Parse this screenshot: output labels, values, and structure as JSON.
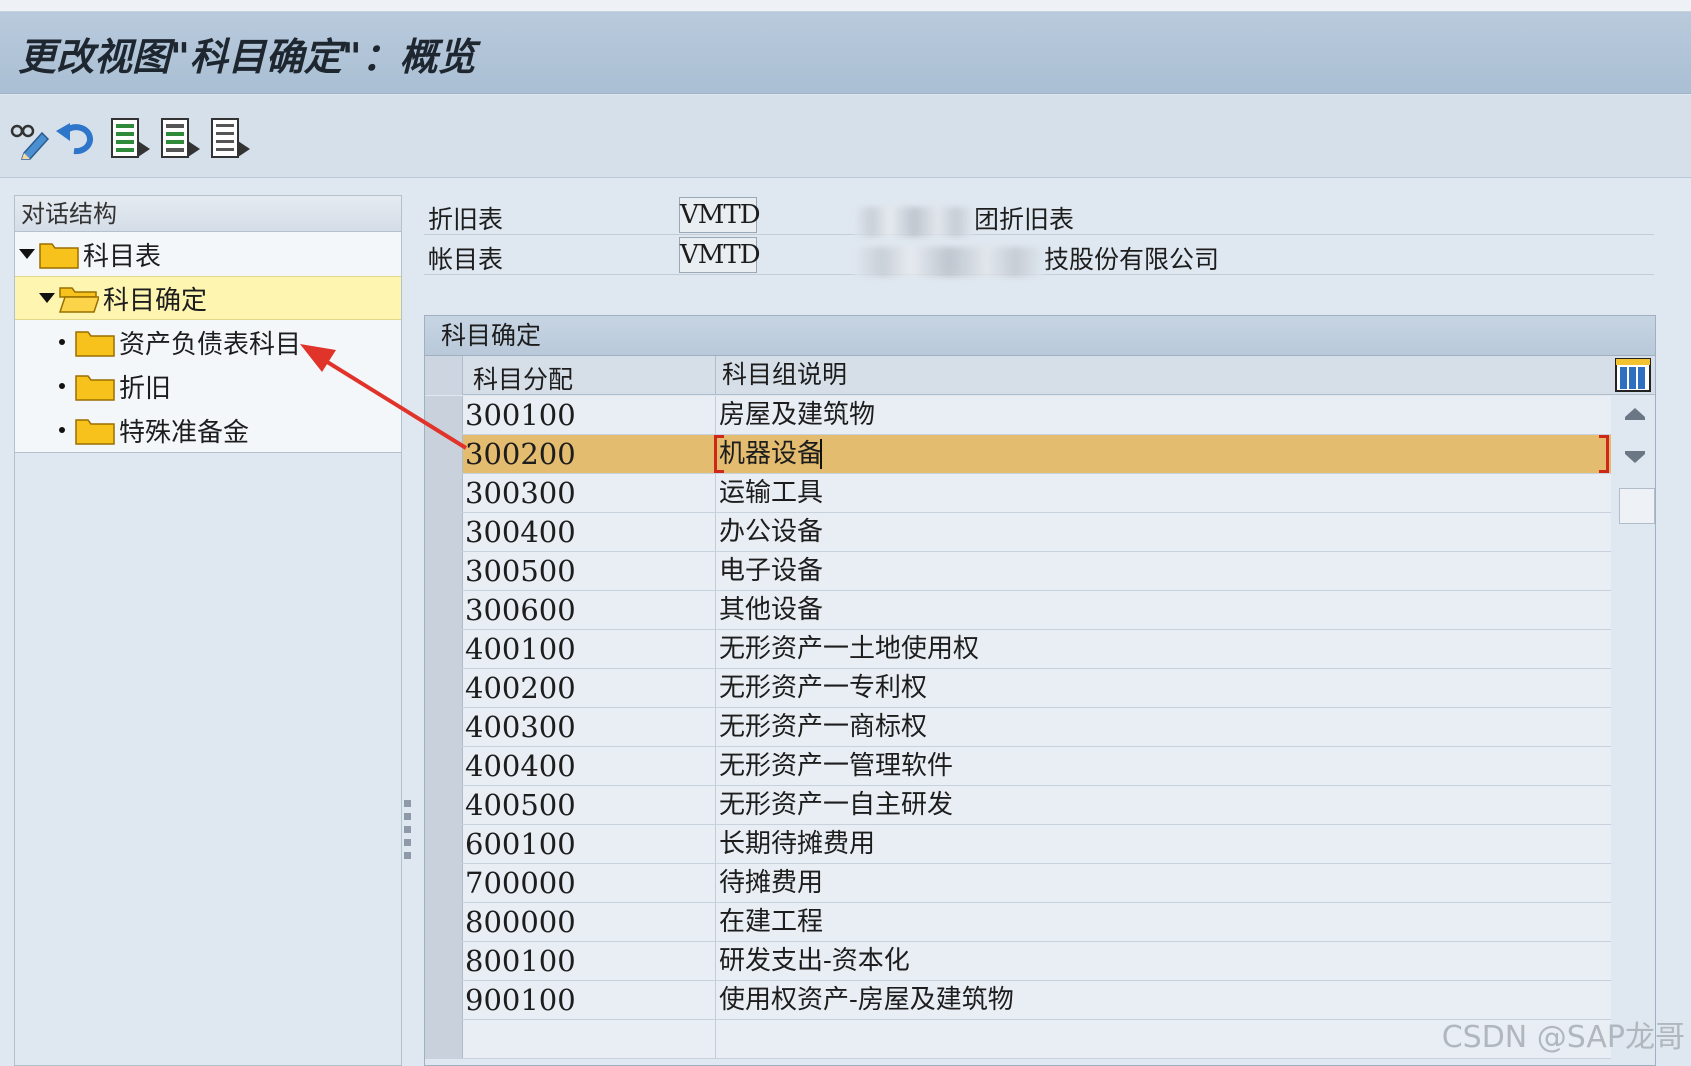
{
  "window": {
    "title": "更改视图\"科目确定\"：概览"
  },
  "toolbar": {
    "buttons": [
      {
        "icon": "display-change-icon"
      },
      {
        "icon": "undo-icon"
      },
      {
        "icon": "select-all-icon"
      },
      {
        "icon": "select-block-icon"
      },
      {
        "icon": "deselect-all-icon"
      }
    ]
  },
  "dialog_structure": {
    "header": "对话结构",
    "items": [
      {
        "label": "科目表"
      },
      {
        "label": "科目确定"
      },
      {
        "label": "资产负债表科目"
      },
      {
        "label": "折旧"
      },
      {
        "label": "特殊准备金"
      }
    ]
  },
  "header_fields": {
    "depr_area_label": "折旧表",
    "depr_area_value": "VMTD",
    "depr_area_desc": "团折旧表",
    "coa_label": "帐目表",
    "coa_value": "VMTD",
    "coa_desc": "技股份有限公司"
  },
  "table": {
    "title": "科目确定",
    "columns": [
      "科目分配",
      "科目组说明"
    ],
    "rows": [
      {
        "acct": "300100",
        "desc": "房屋及建筑物"
      },
      {
        "acct": "300200",
        "desc": "机器设备"
      },
      {
        "acct": "300300",
        "desc": "运输工具"
      },
      {
        "acct": "300400",
        "desc": "办公设备"
      },
      {
        "acct": "300500",
        "desc": "电子设备"
      },
      {
        "acct": "300600",
        "desc": "其他设备"
      },
      {
        "acct": "400100",
        "desc": "无形资产一土地使用权"
      },
      {
        "acct": "400200",
        "desc": "无形资产一专利权"
      },
      {
        "acct": "400300",
        "desc": "无形资产一商标权"
      },
      {
        "acct": "400400",
        "desc": "无形资产一管理软件"
      },
      {
        "acct": "400500",
        "desc": "无形资产一自主研发"
      },
      {
        "acct": "600100",
        "desc": "长期待摊费用"
      },
      {
        "acct": "700000",
        "desc": "待摊费用"
      },
      {
        "acct": "800000",
        "desc": "在建工程"
      },
      {
        "acct": "800100",
        "desc": "研发支出-资本化"
      },
      {
        "acct": "900100",
        "desc": "使用权资产-房屋及建筑物"
      },
      {
        "acct": "",
        "desc": ""
      }
    ]
  },
  "watermark": "CSDN @SAP龙哥",
  "colors": {
    "selected_row": "#e4bc70",
    "tree_selected": "#fdf5b0",
    "annotation_arrow": "#e0332a"
  }
}
